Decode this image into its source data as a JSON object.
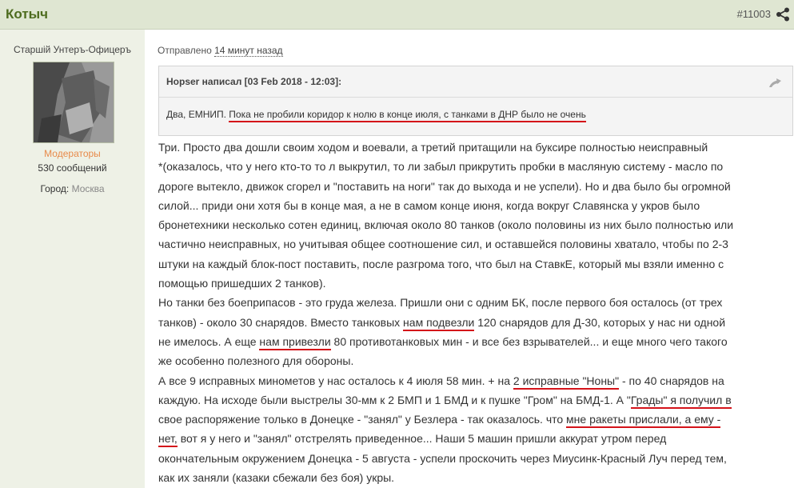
{
  "post": {
    "author": "Котыч",
    "number": "#11003",
    "sent_prefix": "Отправлено",
    "sent_time": "14 минут назад"
  },
  "sidebar": {
    "rank": "Старшiй Унтеръ-Офицеръ",
    "group": "Модераторы",
    "posts": "530 сообщений",
    "city_label": "Город:",
    "city_value": "Москва"
  },
  "quote": {
    "header": "Hopser написал [03 Feb 2018 - 12:03]:",
    "plain": "Два, ЕМНИП. ",
    "underlined": "Пока не пробили коридор к нолю в конце июля, с танками в ДНР было не очень"
  },
  "body_lines": [
    [
      {
        "t": "Три. Просто два дошли своим ходом и воевали, а третий притащили на буксире полностью неисправный"
      }
    ],
    [
      {
        "t": "*(оказалось, что у него кто-то то л выкрутил, то ли забыл прикрутить пробки в масляную систему - масло по"
      }
    ],
    [
      {
        "t": "дороге вытекло, движок сгорел и \"поставить на ноги\" так до выхода и не успели). Но и два было бы огромной"
      }
    ],
    [
      {
        "t": "силой... приди они хотя бы в конце мая, а не в самом конце июня, когда вокруг Славянска у укров было"
      }
    ],
    [
      {
        "t": "бронетехники несколько сотен единиц, включая около 80 танков  (около половины из них было полностью или"
      }
    ],
    [
      {
        "t": "частично неисправных, но учитывая общее соотношение сил, и оставшейся половины хватало, чтобы по 2-3"
      }
    ],
    [
      {
        "t": "штуки на каждый блок-пост поставить, после разгрома того, что был на СтавкЕ, который мы взяли именно с"
      }
    ],
    [
      {
        "t": "помощью пришедших 2 танков)."
      }
    ],
    [
      {
        "t": "Но танки без боеприпасов - это груда железа. Пришли они с одним БК, после первого боя осталось (от трех"
      }
    ],
    [
      {
        "t": "танков) - около 30 снарядов. Вместо танковых "
      },
      {
        "t": "нам подвезли",
        "u": true
      },
      {
        "t": " 120 снарядов для Д-30, которых у нас ни одной"
      }
    ],
    [
      {
        "t": "не имелось. А еще "
      },
      {
        "t": "нам привезли",
        "u": true
      },
      {
        "t": " 80 противотанковых мин - и все без взрывателей... и еще много чего такого"
      }
    ],
    [
      {
        "t": "же особенно полезного для обороны."
      }
    ],
    [
      {
        "t": "А все 9 исправных минометов у нас осталось к 4 июля 58 мин. + на "
      },
      {
        "t": "2 исправные \"Ноны\"",
        "u": true
      },
      {
        "t": " - по 40 снарядов на"
      }
    ],
    [
      {
        "t": "каждую. На исходе были выстрелы 30-мм к 2 БМП и 1 БМД и к пушке \"Гром\" на БМД-1. А \""
      },
      {
        "t": "Грады\" я получил в",
        "u": true
      }
    ],
    [
      {
        "t": "свое распоряжение только в Донецке - \"занял\" у Безлера - так оказалось. что "
      },
      {
        "t": "мне ракеты прислали, а ему -",
        "u": true
      }
    ],
    [
      {
        "t": "нет,",
        "u": true
      },
      {
        "t": " вот я у него и \"занял\"  отстрелять приведенное... Наши 5 машин пришли аккурат утром перед"
      }
    ],
    [
      {
        "t": "окончательным окружением Донецка - 5 августа - успели проскочить через Миусинк-Красный Луч перед тем,"
      }
    ],
    [
      {
        "t": "как их заняли (казаки сбежали без боя) укры."
      }
    ]
  ],
  "icons": {
    "share": "share-icon",
    "quote_collapse": "quote-toggle-icon"
  },
  "colors": {
    "header_bg": "#dfe6d2",
    "author": "#4d6b1e",
    "group": "#e88a4a",
    "underline": "#d4131a"
  }
}
